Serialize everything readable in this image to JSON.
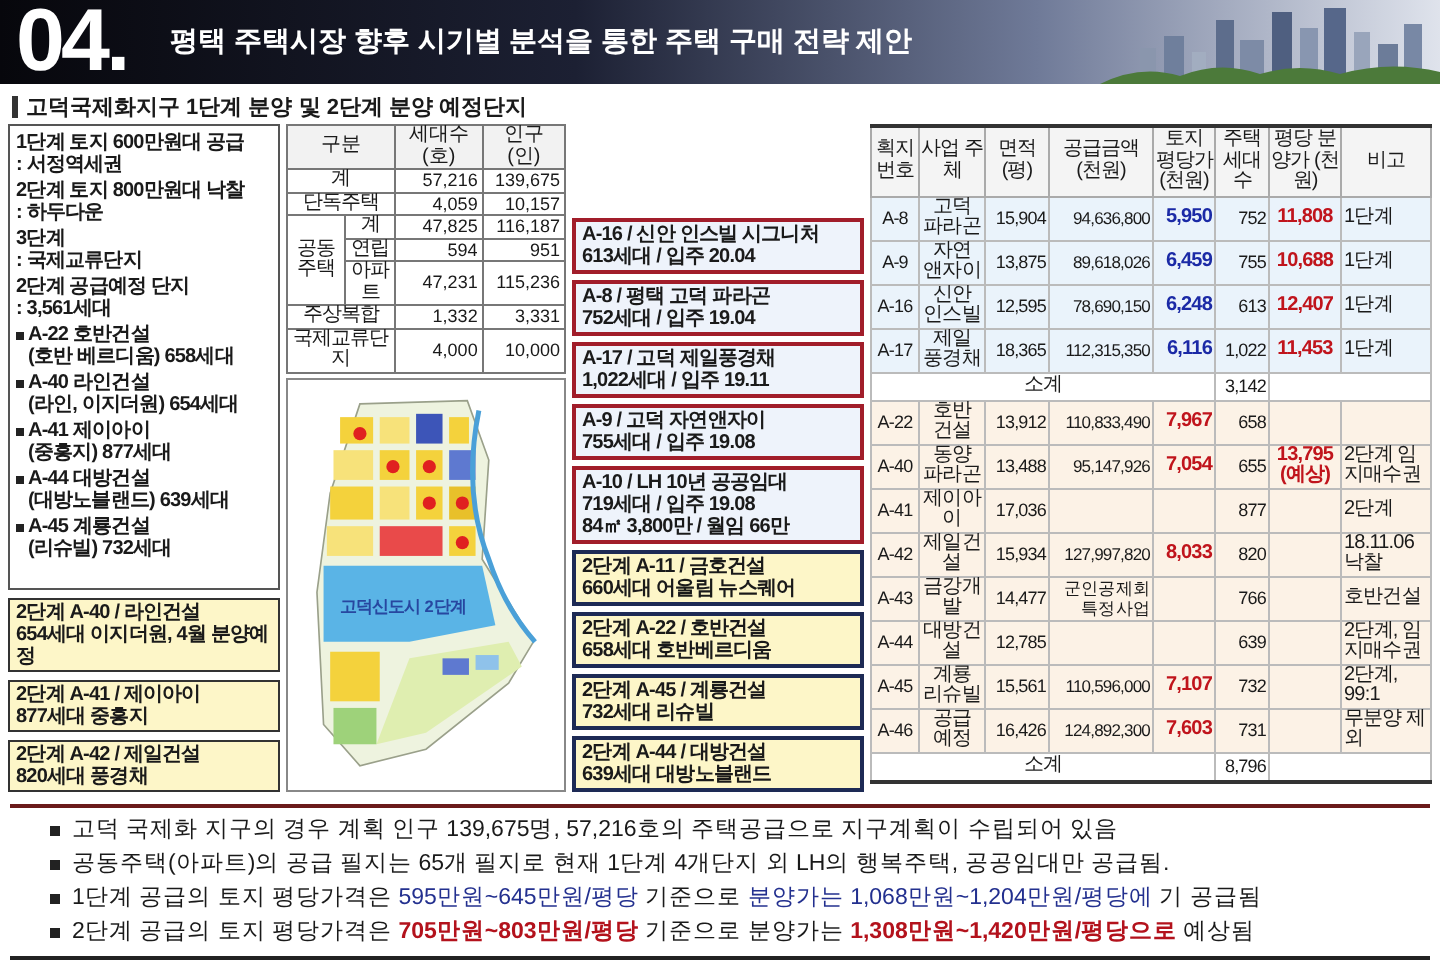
{
  "header": {
    "number": "04.",
    "title": "평택 주택시장 향후  시기별 분석을 통한 주택 구매 전략 제안"
  },
  "section_title": "고덕국제화지구 1단계 분양 및 2단계 분양 예정단지",
  "legend": {
    "blocks": [
      {
        "kind": "note",
        "lines": [
          "1단계 토지 600만원대 공급",
          ": 서정역세권"
        ]
      },
      {
        "kind": "note",
        "lines": [
          "2단계 토지 800만원대 낙찰",
          ": 하두다운"
        ]
      },
      {
        "kind": "note",
        "lines": [
          "3단계",
          ": 국제교류단지"
        ]
      },
      {
        "kind": "note",
        "lines": [
          "2단계 공급예정 단지",
          ": 3,561세대"
        ]
      },
      {
        "kind": "bullet",
        "lines": [
          "A-22 호반건설",
          "(호반 베르디움) 658세대"
        ]
      },
      {
        "kind": "bullet",
        "lines": [
          "A-40 라인건설",
          "(라인, 이지더원) 654세대"
        ]
      },
      {
        "kind": "bullet",
        "lines": [
          "A-41 제이아이",
          "(중흥지) 877세대"
        ]
      },
      {
        "kind": "bullet",
        "lines": [
          "A-44 대방건설",
          "(대방노블랜드) 639세대"
        ]
      },
      {
        "kind": "bullet",
        "lines": [
          "A-45 계룡건설",
          "(리슈빌) 732세대"
        ]
      }
    ],
    "boxes": [
      {
        "lines": [
          "2단계 A-40 / 라인건설",
          "654세대 이지더원, 4월 분양예정"
        ]
      },
      {
        "lines": [
          "2단계 A-41 / 제이아이",
          "877세대 중흥지"
        ]
      },
      {
        "lines": [
          "2단계 A-42 / 제일건설",
          "820세대 풍경채"
        ]
      }
    ]
  },
  "summary_table": {
    "columns": [
      "구분",
      "세대수 (호)",
      "인구 (인)"
    ],
    "rows": [
      {
        "kind": "single",
        "label": "계",
        "cells": [
          "57,216",
          "139,675"
        ]
      },
      {
        "kind": "single",
        "label": "단독주택",
        "cells": [
          "4,059",
          "10,157"
        ]
      },
      {
        "kind": "group",
        "label": "공동주택",
        "children": [
          {
            "label": "계",
            "cells": [
              "47,825",
              "116,187"
            ]
          },
          {
            "label": "연립",
            "cells": [
              "594",
              "951"
            ]
          },
          {
            "label": "아파트",
            "cells": [
              "47,231",
              "115,236"
            ]
          }
        ]
      },
      {
        "kind": "single",
        "label": "주상복합",
        "cells": [
          "1,332",
          "3,331"
        ]
      },
      {
        "kind": "single",
        "label": "국제교류단지",
        "cells": [
          "4,000",
          "10,000"
        ]
      }
    ]
  },
  "map": {
    "label": "고덕신도시 2단계"
  },
  "callouts": [
    {
      "kind": "phase1",
      "lines": [
        "A-16 / 신안 인스빌 시그니처",
        "613세대 / 입주 20.04"
      ]
    },
    {
      "kind": "phase1",
      "lines": [
        "A-8 / 평택 고덕 파라곤",
        "752세대 / 입주 19.04"
      ]
    },
    {
      "kind": "phase1",
      "lines": [
        "A-17 / 고덕 제일풍경채",
        "1,022세대 / 입주 19.11"
      ]
    },
    {
      "kind": "phase1",
      "lines": [
        "A-9 / 고덕 자연앤자이",
        "755세대 / 입주 19.08"
      ]
    },
    {
      "kind": "phase1",
      "lines": [
        "A-10 / LH 10년 공공임대",
        "719세대 / 입주 19.08",
        "84㎡ 3,800만 / 월임 66만"
      ]
    },
    {
      "kind": "phase2",
      "lines": [
        "2단계 A-11 / 금호건설",
        "660세대 어울림 뉴스퀘어"
      ]
    },
    {
      "kind": "phase2",
      "lines": [
        "2단계 A-22 / 호반건설",
        "658세대 호반베르디움"
      ]
    },
    {
      "kind": "phase2",
      "lines": [
        "2단계 A-45 / 계룡건설",
        "732세대 리슈빌"
      ]
    },
    {
      "kind": "phase2",
      "lines": [
        "2단계 A-44 / 대방건설",
        "639세대 대방노블랜드"
      ]
    }
  ],
  "plot_table": {
    "columns": [
      "획지 번호",
      "사업 주체",
      "면적 (평)",
      "공급금액 (천원)",
      "토지 평당가 (천원)",
      "주택 세대수",
      "평당 분양가 (천원)",
      "비고"
    ],
    "rows": [
      {
        "kind": "phase1",
        "cells": [
          "A-8",
          "고덕 파라곤",
          "15,904",
          "94,636,800",
          "5,950",
          "752",
          "11,808",
          "1단계"
        ]
      },
      {
        "kind": "phase1",
        "cells": [
          "A-9",
          "자연 앤자이",
          "13,875",
          "89,618,026",
          "6,459",
          "755",
          "10,688",
          "1단계"
        ]
      },
      {
        "kind": "phase1",
        "cells": [
          "A-16",
          "신안 인스빌",
          "12,595",
          "78,690,150",
          "6,248",
          "613",
          "12,407",
          "1단계"
        ]
      },
      {
        "kind": "phase1",
        "cells": [
          "A-17",
          "제일 풍경채",
          "18,365",
          "112,315,350",
          "6,116",
          "1,022",
          "11,453",
          "1단계"
        ]
      },
      {
        "kind": "subtotal",
        "label": "소계",
        "units": "3,142"
      },
      {
        "kind": "phase2",
        "cells": [
          "A-22",
          "호반 건설",
          "13,912",
          "110,833,490",
          "7,967",
          "658",
          null,
          null
        ]
      },
      {
        "kind": "phase2",
        "cells": [
          "A-40",
          "동양 파라곤",
          "13,488",
          "95,147,926",
          "7,054",
          "655",
          "13,795 (예상)",
          "2단계 임지매수권"
        ]
      },
      {
        "kind": "phase2",
        "cells": [
          "A-41",
          "제이아이",
          "17,036",
          null,
          null,
          "877",
          null,
          "2단계"
        ]
      },
      {
        "kind": "phase2",
        "cells": [
          "A-42",
          "제일건설",
          "15,934",
          "127,997,820",
          "8,033",
          "820",
          null,
          "18.11.06 낙찰"
        ]
      },
      {
        "kind": "phase2",
        "cells": [
          "A-43",
          "금강개발",
          "14,477",
          "군인공제회 특정사업",
          null,
          "766",
          null,
          "호반건설"
        ]
      },
      {
        "kind": "phase2",
        "cells": [
          "A-44",
          "대방건설",
          "12,785",
          null,
          null,
          "639",
          null,
          "2단계, 임지매수권"
        ]
      },
      {
        "kind": "phase2",
        "cells": [
          "A-45",
          "계룡 리슈빌",
          "15,561",
          "110,596,000",
          "7,107",
          "732",
          null,
          "2단계, 99:1"
        ]
      },
      {
        "kind": "phase2",
        "cells": [
          "A-46",
          "공급 예정",
          "16,426",
          "124,892,300",
          "7,603",
          "731",
          null,
          "무분양 제외"
        ]
      },
      {
        "kind": "subtotal",
        "label": "소계",
        "units": "8,796"
      }
    ]
  },
  "bullets": [
    {
      "segments": [
        {
          "text": "고덕 국제화 지구의 경우 계획 인구 139,675명, 57,216호의 주택공급으로 지구계획이 수립되어 있음"
        }
      ]
    },
    {
      "segments": [
        {
          "text": "공동주택(아파트)의 공급 필지는 65개 필지로 현재 1단계 4개단지 외  LH의 행복주택, 공공임대만 공급됨."
        }
      ]
    },
    {
      "segments": [
        {
          "text": "1단계 공급의 토지 평당가격은 "
        },
        {
          "text": "595만원~645만원/평당",
          "color": "#23308f"
        },
        {
          "text": " 기준으로 "
        },
        {
          "text": "분양가는 1,068만원~1,204만원/평당에",
          "color": "#23308f"
        },
        {
          "text": " 기 공급됨"
        }
      ]
    },
    {
      "segments": [
        {
          "text": "2단계 공급의 토지 평당가격은 "
        },
        {
          "text": "**705만원~803만원/평당**",
          "color": "#b3121c"
        },
        {
          "text": " 기준으로 분양가는  "
        },
        {
          "text": "**1,308만원~1,420만원/평당으로**",
          "color": "#b3121c"
        },
        {
          "text": " 예상됨"
        }
      ]
    }
  ]
}
